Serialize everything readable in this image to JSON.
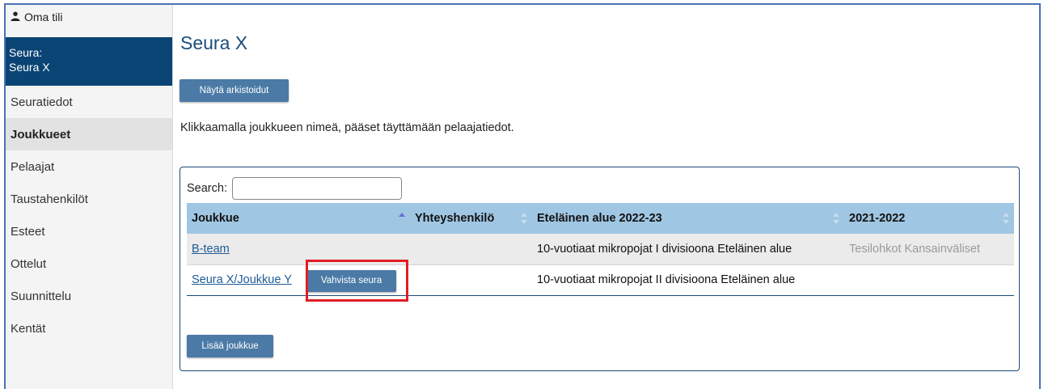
{
  "sidebar": {
    "account_label": "Oma tili",
    "club_prefix": "Seura:",
    "club_name": "Seura X",
    "items": [
      {
        "label": "Seuratiedot"
      },
      {
        "label": "Joukkueet"
      },
      {
        "label": "Pelaajat"
      },
      {
        "label": "Taustahenkilöt"
      },
      {
        "label": "Esteet"
      },
      {
        "label": "Ottelut"
      },
      {
        "label": "Suunnittelu"
      },
      {
        "label": "Kentät"
      }
    ],
    "active_item": "Joukkueet"
  },
  "main": {
    "title": "Seura X",
    "archive_button": "Näytä arkistoidut",
    "info_text": "Klikkaamalla joukkueen nimeä, pääset täyttämään pelaajatiedot.",
    "search": {
      "label": "Search:",
      "value": ""
    },
    "table": {
      "columns": [
        "Joukkue",
        "Yhteyshenkilö",
        "Eteläinen alue 2022-23",
        "2021-2022"
      ],
      "sorted_column": "Joukkue",
      "sort_direction": "ascending",
      "rows": [
        {
          "team": "B-team",
          "contact": "",
          "region": "10-vuotiaat mikropojat I divisioona Eteläinen alue",
          "prev": "Tesilohkot Kansainväliset"
        },
        {
          "team": "Seura X/Joukkue Y",
          "contact": "",
          "region": "10-vuotiaat mikropojat II divisioona Eteläinen alue",
          "prev": "",
          "action_button": "Vahvista seura"
        }
      ]
    },
    "add_button": "Lisää joukkue"
  },
  "colors": {
    "sidebar_club_bg": "#0a4475",
    "button_bg": "#4b7aa6",
    "table_header_bg": "#9fc6e2",
    "highlight": "#e01e24",
    "title": "#1a4d7c"
  }
}
